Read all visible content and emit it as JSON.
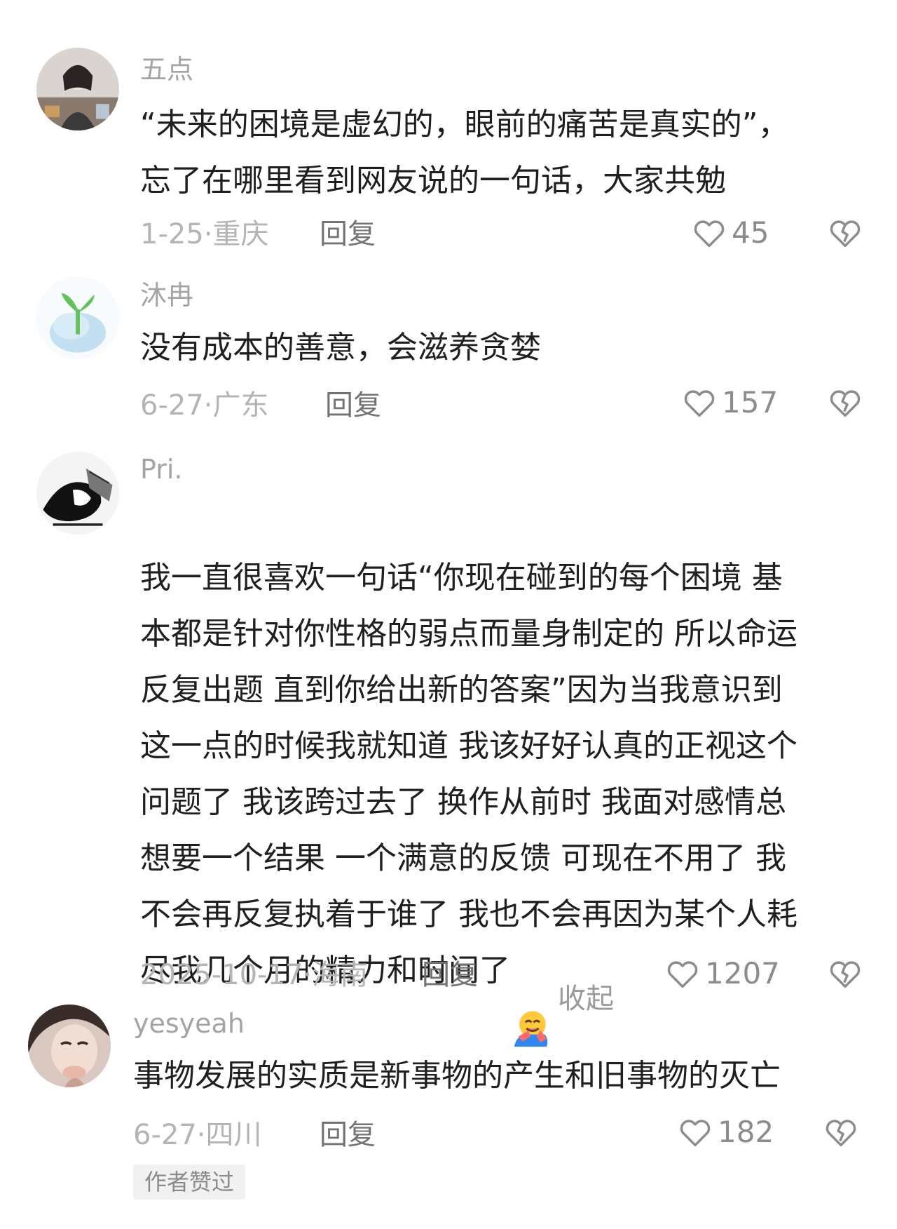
{
  "comments": [
    {
      "username": "五点",
      "text": "“未来的困境是虚幻的，眼前的痛苦是真实的”，\n忘了在哪里看到网友说的一句话，大家共勉",
      "date_location": "1-25·重庆",
      "reply_label": "回复",
      "likes": "45"
    },
    {
      "username": "沐冉",
      "text": "没有成本的善意，会滋养贪婪",
      "date_location": "6-27·广东",
      "reply_label": "回复",
      "likes": "157"
    },
    {
      "username": "Pri.",
      "text": "我一直很喜欢一句话“你现在碰到的每个困境 基\n本都是针对你性格的弱点而量身制定的 所以命运\n反复出题 直到你给出新的答案”因为当我意识到\n这一点的时候我就知道 我该好好认真的正视这个\n问题了 我该跨过去了 换作从前时 我面对感情总\n想要一个结果 一个满意的反馈 可现在不用了 我\n不会再反复执着于谁了 我也不会再因为某个人耗\n尽我几个月的精力和时间了",
      "emoji": "hugging-face-emoji",
      "collapse_label": "收起",
      "date_location": "2025-10-17·海南",
      "reply_label": "回复",
      "likes": "1207"
    },
    {
      "username": "yesyeah",
      "text": "事物发展的实质是新事物的产生和旧事物的灭亡",
      "date_location": "6-27·四川",
      "reply_label": "回复",
      "likes": "182",
      "badge": "作者赞过"
    }
  ],
  "icons": {
    "like": "heart-outline-icon",
    "dislike": "broken-heart-outline-icon"
  },
  "colors": {
    "text": "#1f1f1f",
    "username": "#a4a4a4",
    "meta": "#b4b4b4",
    "reply": "#737373"
  }
}
